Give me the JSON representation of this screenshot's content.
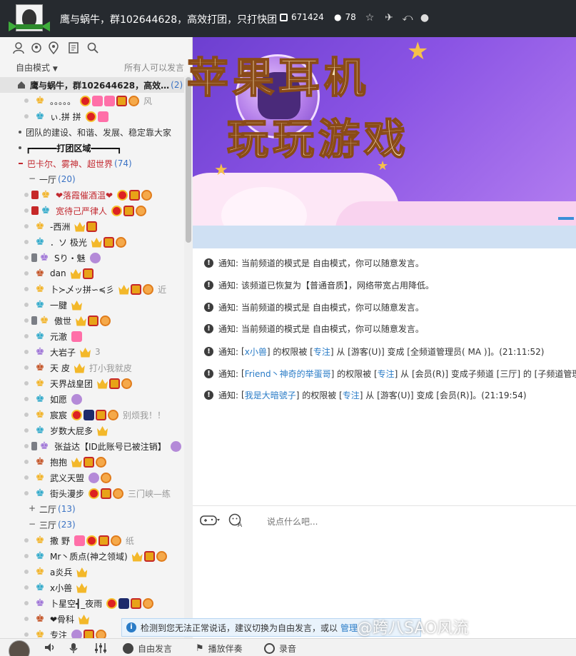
{
  "header": {
    "title": "鹰与蜗牛，群102644628，高效打团，只打快团",
    "channel_id": "671424",
    "online_count": "78",
    "icons": [
      "id-badge-icon",
      "user-icon",
      "star-icon",
      "plane-icon",
      "share-icon",
      "alert-icon"
    ]
  },
  "left": {
    "tools": [
      "user-icon",
      "refresh-user-icon",
      "location-icon",
      "notes-icon",
      "search-icon"
    ],
    "mode": "自由模式",
    "mode_hint": "所有人可以发言",
    "root": {
      "name": "鹰与蜗牛，群102644628，高效…",
      "count": "(2)"
    },
    "root_users": [
      {
        "name": "。。。。。",
        "tail": "风"
      },
      {
        "name": "ぃ.拼 拼"
      }
    ],
    "channels": [
      {
        "name": "团队的建设、和谐、发展、稳定靠大家"
      },
      {
        "name": "┏━━━━━打团区域━━━━━┓"
      },
      {
        "name": "巴卡尔、雾神、超世界",
        "count": "(74)"
      }
    ],
    "sub1": {
      "name": "一厅",
      "count": "(20)"
    },
    "sub1_users": [
      {
        "name": "❤落霞催酒温❤",
        "red": true
      },
      {
        "name": "宽待己严律人",
        "red": true
      },
      {
        "name": "-西洲"
      },
      {
        "name": "．ソ 极光"
      },
      {
        "name": "Sり・魅"
      },
      {
        "name": "dan"
      },
      {
        "name": "卜≻乄ッ拼∽≼彡",
        "tail": "近"
      },
      {
        "name": "一腱"
      },
      {
        "name": "傲世"
      },
      {
        "name": "元澈"
      },
      {
        "name": "大岩子",
        "tail": "3"
      },
      {
        "name": "天 皮",
        "tail": "打小我就皮"
      },
      {
        "name": "天界战皇团"
      },
      {
        "name": "如愿"
      },
      {
        "name": "宸宸",
        "tail": "别烦我！！"
      },
      {
        "name": "岁数大屁多"
      },
      {
        "name": "张益达【ID此账号已被注销】"
      },
      {
        "name": "抱抱"
      },
      {
        "name": "武义天盟"
      },
      {
        "name": "街头漫步",
        "tail": "三门峡—练"
      }
    ],
    "sub2": {
      "name": "二厅",
      "count": "(13)"
    },
    "sub3": {
      "name": "三厅",
      "count": "(23)"
    },
    "sub3_users": [
      {
        "name": "撒 野",
        "tail": "纸"
      },
      {
        "name": "Mr丶质点(神之领域)"
      },
      {
        "name": "a炎兵"
      },
      {
        "name": "x小兽"
      },
      {
        "name": "卜星空┫_夜雨"
      },
      {
        "name": "❤骨科"
      },
      {
        "name": "专注"
      }
    ]
  },
  "banner": {
    "line1": "苹果耳机",
    "line2": "玩玩游戏"
  },
  "messages": [
    {
      "label": "通知:",
      "text": "当前频道的模式是 自由模式，你可以随意发言。"
    },
    {
      "label": "通知:",
      "text": "该频道已恢复为【普通音质】，网络带宽占用降低。"
    },
    {
      "label": "通知:",
      "text": "当前频道的模式是 自由模式，你可以随意发言。"
    },
    {
      "label": "通知:",
      "text": "当前频道的模式是 自由模式，你可以随意发言。"
    },
    {
      "label": "通知:",
      "p1": "[",
      "user": "x小兽",
      "p2": "] 的权限被 [",
      "by": "专注",
      "p3": "] 从 [游客(U)] 变成 [全频道管理员( MA )]。(21:11:52)"
    },
    {
      "label": "通知:",
      "p1": "[",
      "user": "Friend丶神奇的举蛋哥",
      "p2": "] 的权限被 [",
      "by": "专注",
      "p3": "] 从 [会员(R)] 变成子频道 [三厅] 的 [子频道管理"
    },
    {
      "label": "通知:",
      "p1": "[",
      "user": "我是大暗號子",
      "p2": "] 的权限被 [",
      "by": "专注",
      "p3": "] 从 [游客(U)] 变成 [会员(R)]。(21:19:54)"
    }
  ],
  "input": {
    "placeholder": "说点什么吧..."
  },
  "toast": {
    "text": "检测到您无法正常说话，建议切换为自由发言，或以",
    "link": "管理"
  },
  "watermark": "@跨八SAO风流",
  "bottom": {
    "free_speak": "自由发言",
    "play_music": "播放伴奏",
    "record": "录音"
  }
}
